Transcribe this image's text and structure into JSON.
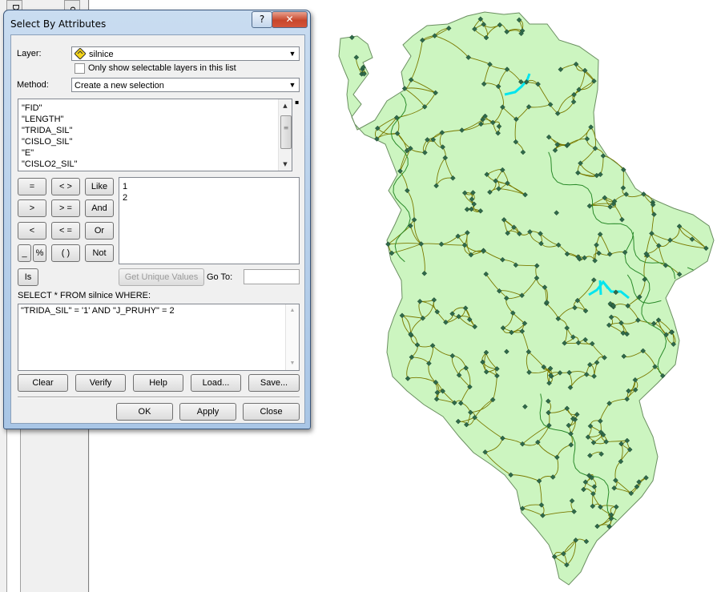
{
  "left_panel": {
    "tabs": [
      "D A",
      "oo"
    ]
  },
  "dialog": {
    "title": "Select By Attributes",
    "title_help_label": "?",
    "title_close_label": "✕",
    "layer_label": "Layer:",
    "layer_value": "silnice",
    "only_selectable_label": "Only show selectable layers in this list",
    "method_label": "Method:",
    "method_value": "Create a new selection",
    "fields": [
      "\"FID\"",
      "\"LENGTH\"",
      "\"TRIDA_SIL\"",
      "\"CISLO_SIL\"",
      "\"E\"",
      "\"CISLO2_SIL\""
    ],
    "operators": {
      "eq": "=",
      "ne": "< >",
      "like": "Like",
      "gt": ">",
      "ge": "> =",
      "and": "And",
      "lt": "<",
      "le": "< =",
      "or": "Or",
      "underscore": "_",
      "percent": "%",
      "parens": "( )",
      "not": "Not",
      "is": "Is"
    },
    "unique_values": [
      "1",
      "2"
    ],
    "get_unique_values_label": "Get Unique Values",
    "goto_label": "Go To:",
    "goto_value": "",
    "sql_prefix": "SELECT * FROM silnice WHERE:",
    "sql_expression": "\"TRIDA_SIL\" = '1' AND \"J_PRUHY\" = 2",
    "buttons": {
      "clear": "Clear",
      "verify": "Verify",
      "help": "Help",
      "load": "Load...",
      "save": "Save...",
      "ok": "OK",
      "apply": "Apply",
      "close": "Close"
    }
  },
  "map": {
    "layer_fill": "#ccf5c0",
    "road_color": "#7a7a00",
    "river_color": "#2a8a2a",
    "node_color": "#2f6a4a",
    "selected_road_color": "#00e5ee"
  }
}
